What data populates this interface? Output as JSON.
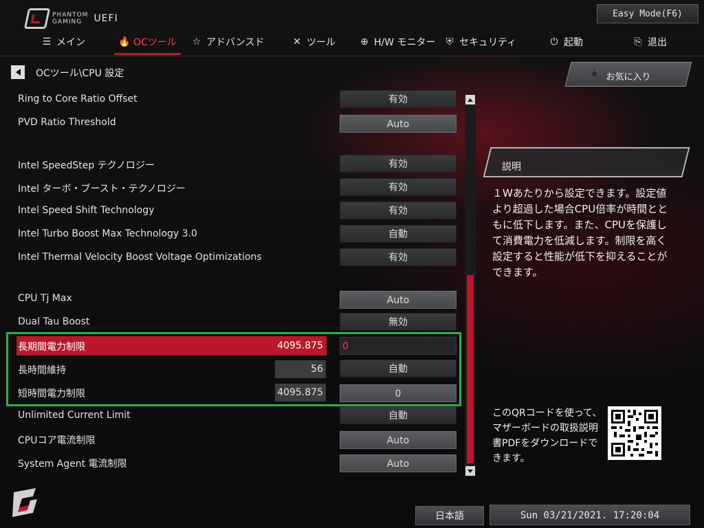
{
  "header": {
    "brand_line1": "PHANTOM",
    "brand_line2": "GAMING",
    "product": "UEFI",
    "easy_mode": "Easy Mode(F6)"
  },
  "tabs": [
    {
      "label": "メイン",
      "icon": "list-icon",
      "active": false
    },
    {
      "label": "OCツール",
      "icon": "flame-icon",
      "active": true
    },
    {
      "label": "アドバンスド",
      "icon": "star-icon",
      "active": false
    },
    {
      "label": "ツール",
      "icon": "wrench-icon",
      "active": false
    },
    {
      "label": "H/W モニター",
      "icon": "crosshair-icon",
      "active": false
    },
    {
      "label": "セキュリティ",
      "icon": "shield-icon",
      "active": false
    },
    {
      "label": "起動",
      "icon": "power-icon",
      "active": false
    },
    {
      "label": "退出",
      "icon": "exit-icon",
      "active": false
    }
  ],
  "breadcrumb": "OCツール\\CPU 設定",
  "settings": [
    {
      "label": "Ring to Core Ratio Offset",
      "value": "有効"
    },
    {
      "label": "PVD Ratio Threshold",
      "value": "Auto"
    },
    {
      "label": "Intel SpeedStep テクノロジー",
      "value": "有効"
    },
    {
      "label": "Intel ターボ・ブースト・テクノロジー",
      "value": "有効"
    },
    {
      "label": "Intel Speed Shift Technology",
      "value": "有効"
    },
    {
      "label": "Intel Turbo Boost Max Technology 3.0",
      "value": "自動"
    },
    {
      "label": "Intel Thermal Velocity Boost Voltage Optimizations",
      "value": "有効"
    },
    {
      "label": "CPU Tj Max",
      "value": "Auto"
    },
    {
      "label": "Dual Tau Boost",
      "value": "無効"
    },
    {
      "label": "長期間電力制限",
      "current": "4095.875",
      "value": "0"
    },
    {
      "label": "長時間維持",
      "current": "56",
      "value": "自動"
    },
    {
      "label": "短時間電力制限",
      "current": "4095.875",
      "value": "0"
    },
    {
      "label": "Unlimited Current Limit",
      "value": "自動"
    },
    {
      "label": "CPUコア電流制限",
      "value": "Auto"
    },
    {
      "label": "System Agent 電流制限",
      "value": "Auto"
    }
  ],
  "favorites_label": "お気に入り",
  "explanation": {
    "title": "説明",
    "text": "１Wあたりから設定できます。設定値より超過した場合CPU倍率が時間とともに低下します。また、CPUを保護して消費電力を低減します。制限を高く設定すると性能が低下を抑えることができます。"
  },
  "qr_text": "このQRコードを使って、マザーボードの取扱説明書PDFをダウンロードできます。",
  "footer": {
    "language": "日本語",
    "datetime": "Sun 03/21/2021. 17:20:04"
  },
  "colors": {
    "accent_red": "#c0162b",
    "highlight_green": "#2bb24c"
  }
}
